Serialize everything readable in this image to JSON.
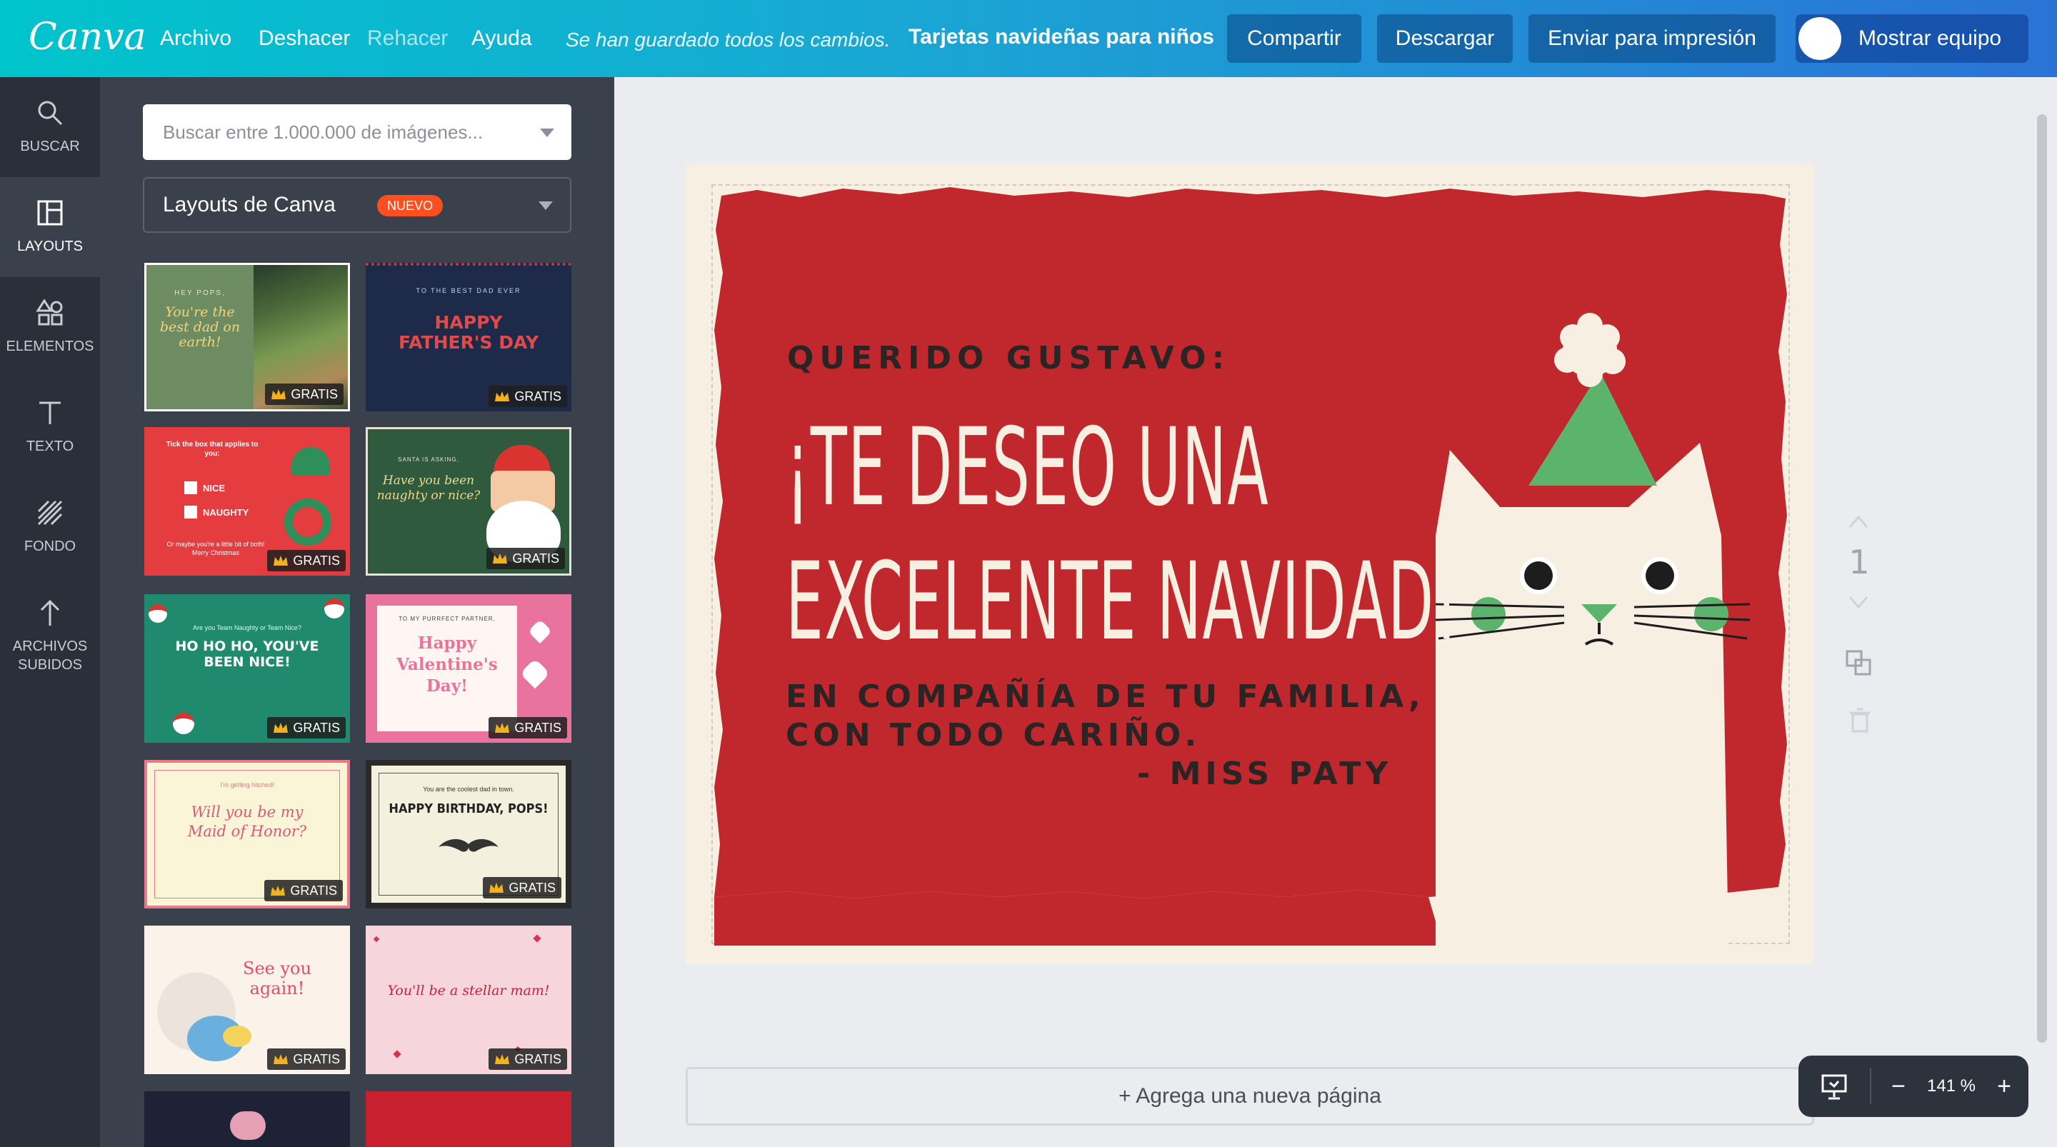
{
  "topbar": {
    "logo": "Canva",
    "menu": [
      "Archivo",
      "Deshacer",
      "Rehacer",
      "Ayuda"
    ],
    "saved_status": "Se han guardado todos los cambios.",
    "document_title": "Tarjetas navideñas para niños",
    "share_label": "Compartir",
    "download_label": "Descargar",
    "print_label": "Enviar para impresión",
    "team_label": "Mostrar equipo"
  },
  "sidebar": {
    "items": [
      {
        "label": "BUSCAR",
        "icon": "search-icon"
      },
      {
        "label": "LAYOUTS",
        "icon": "layouts-icon"
      },
      {
        "label": "ELEMENTOS",
        "icon": "shapes-icon"
      },
      {
        "label": "TEXTO",
        "icon": "text-icon"
      },
      {
        "label": "FONDO",
        "icon": "background-icon"
      },
      {
        "label": "ARCHIVOS",
        "label2": "SUBIDOS",
        "icon": "upload-icon"
      }
    ],
    "active": "LAYOUTS"
  },
  "panel": {
    "search_placeholder": "Buscar entre 1.000.000 de imágenes...",
    "dropdown_label": "Layouts de Canva",
    "new_badge": "NUEVO",
    "badge_label": "GRATIS",
    "templates": [
      {
        "title": "You're the best dad on earth!",
        "pre": "HEY POPS,"
      },
      {
        "title": "HAPPY FATHER'S DAY",
        "pre": "TO THE BEST DAD EVER"
      },
      {
        "title": "Tick the box that applies to you:",
        "opt1": "NICE",
        "opt2": "NAUGHTY",
        "note": "Or maybe you're a little bit of both! Merry Christmas"
      },
      {
        "title": "Have you been naughty or nice?",
        "pre": "SANTA IS ASKING,"
      },
      {
        "title": "HO HO HO, YOU'VE BEEN NICE!",
        "pre": "Are you Team Naughty or Team Nice?"
      },
      {
        "title": "Happy Valentine's Day!",
        "pre": "TO MY PURRFECT PARTNER,"
      },
      {
        "title": "Will you be my Maid of Honor?",
        "pre": "I'm getting hitched!"
      },
      {
        "title": "HAPPY BIRTHDAY, POPS!",
        "pre": "You are the coolest dad in town."
      },
      {
        "title": "See you again!"
      },
      {
        "title": "You'll be a stellar mam!"
      }
    ]
  },
  "card": {
    "greeting": "QUERIDO GUSTAVO:",
    "headline_line1": "¡TE DESEO UNA",
    "headline_line2": "EXCELENTE NAVIDAD!",
    "message_line1": "EN COMPAÑÍA DE TU FAMILIA,",
    "message_line2": "CON TODO CARIÑO.",
    "signature": "- MISS PATY",
    "colors": {
      "red": "#c0282d",
      "cream": "#f6efe2",
      "hat_green": "#5cb46c",
      "ink": "#2a2424"
    }
  },
  "canvas": {
    "page_number": "1",
    "add_page_label": "+ Agrega una nueva página",
    "zoom_label": "141 %"
  }
}
